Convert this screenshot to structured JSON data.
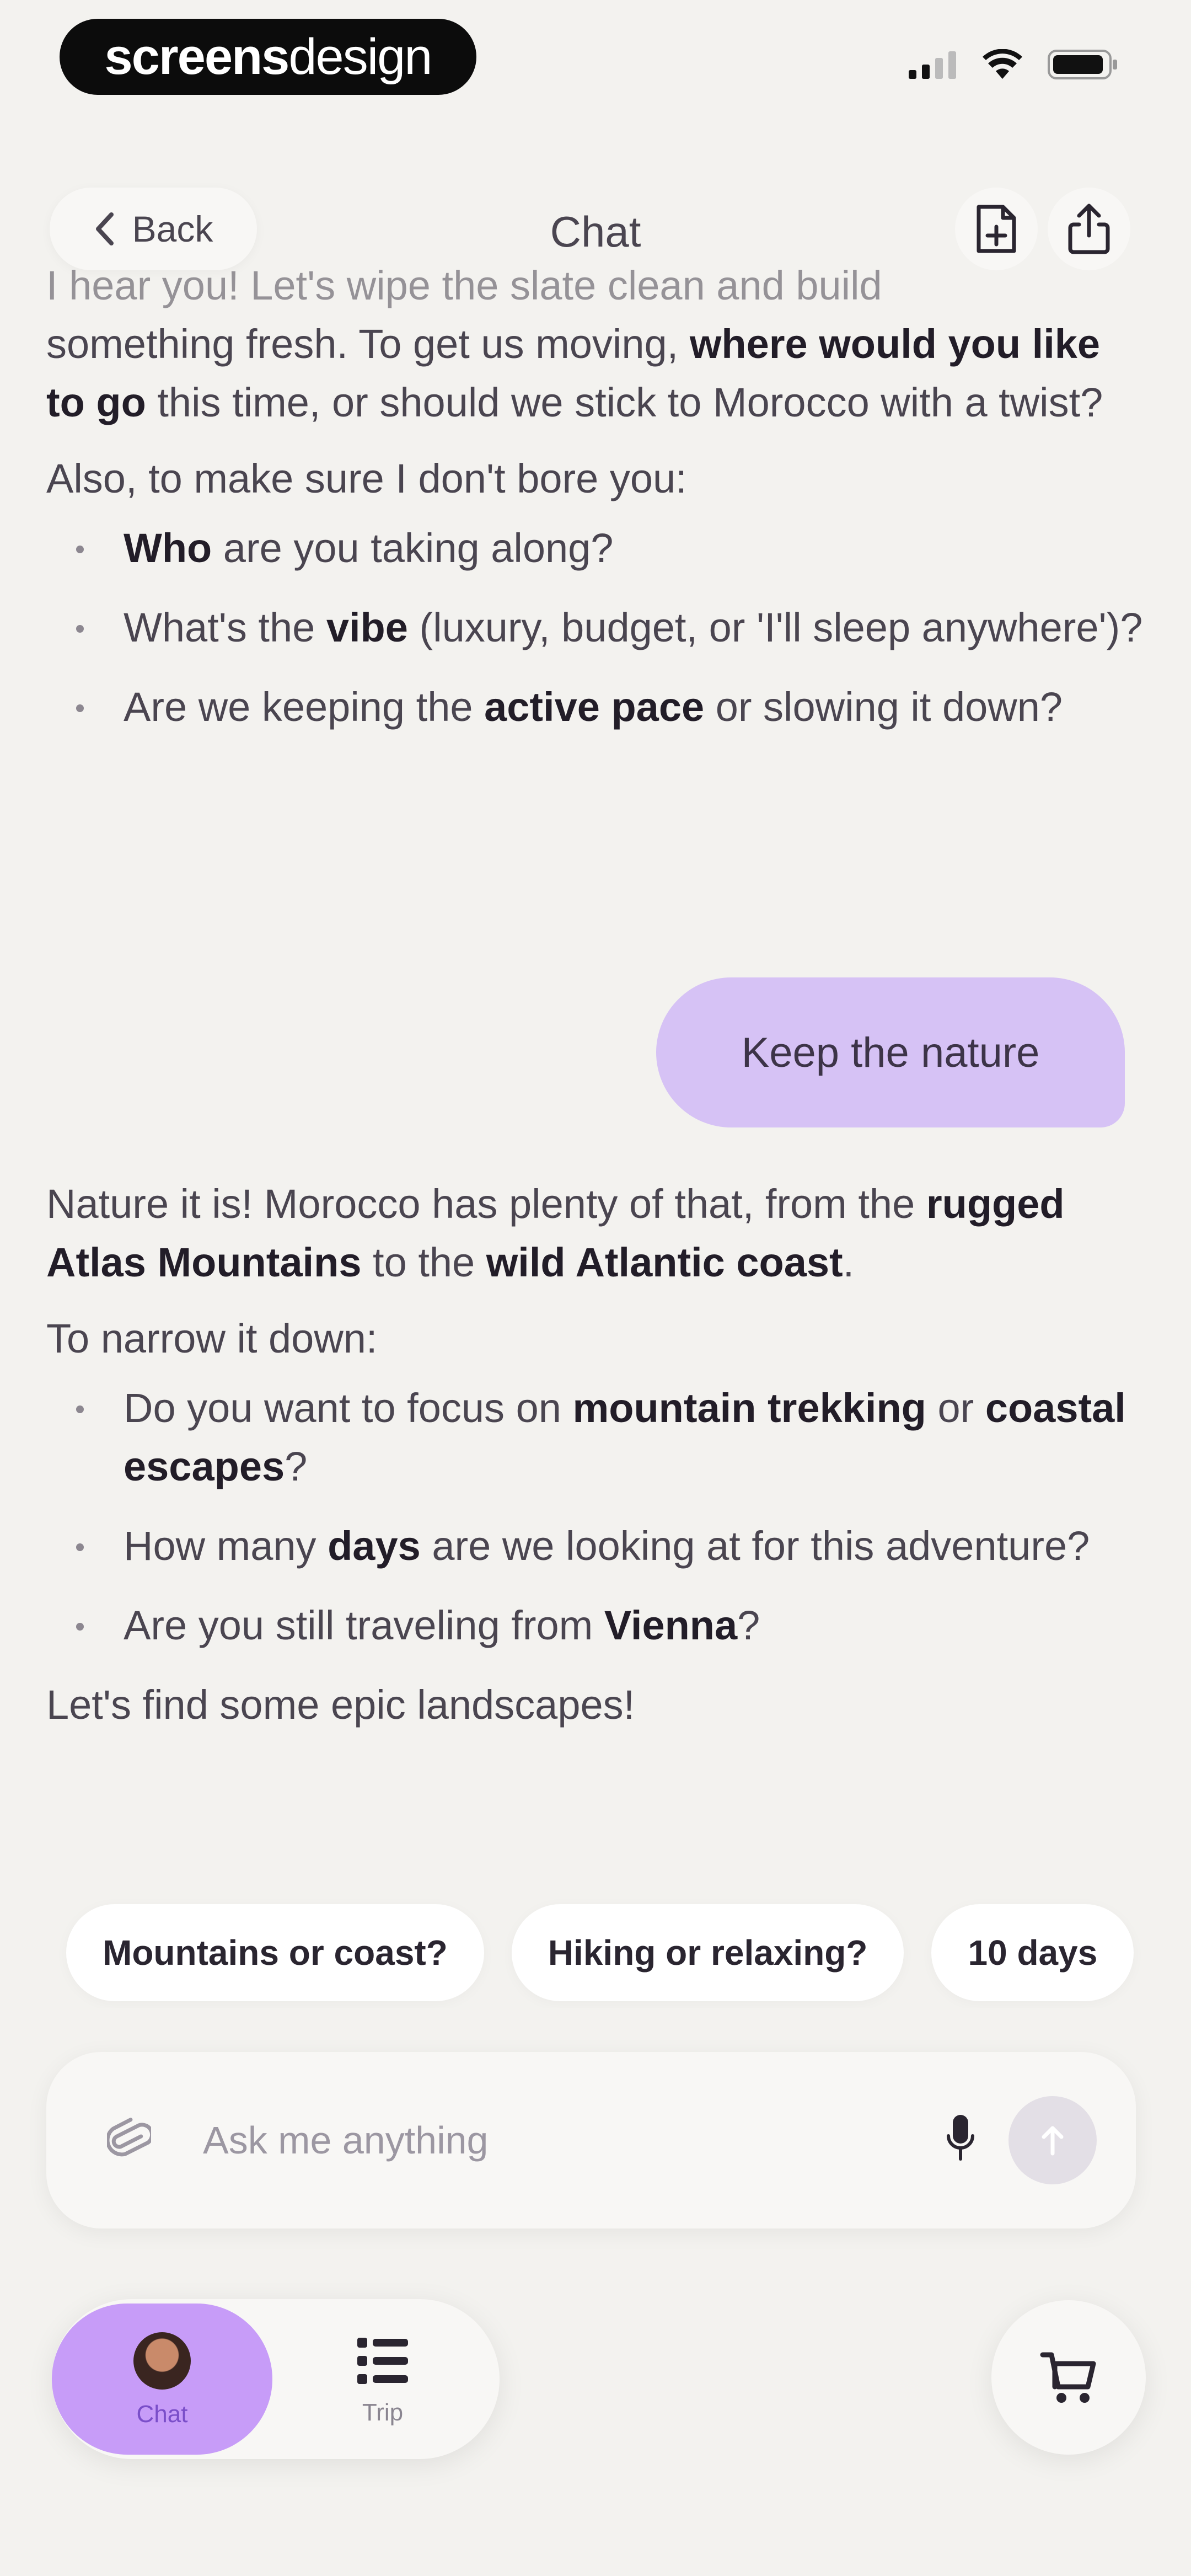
{
  "brand": {
    "part1": "screens",
    "part2": "design"
  },
  "header": {
    "back_label": "Back",
    "title": "Chat"
  },
  "messages": {
    "ai1_tail": "I hear you! Let's wipe the slate clean and build",
    "ai1_p1_a": "something fresh. To get us moving, ",
    "ai1_p1_b": "where would you like to go",
    "ai1_p1_c": " this time, or should we stick to Morocco with a twist?",
    "ai1_p2": "Also, to make sure I don't bore you:",
    "ai1_b1_a": "Who",
    "ai1_b1_b": " are you taking along?",
    "ai1_b2_a": "What's the ",
    "ai1_b2_b": "vibe",
    "ai1_b2_c": " (luxury, budget, or 'I'll sleep anywhere')?",
    "ai1_b3_a": "Are we keeping the ",
    "ai1_b3_b": "active pace",
    "ai1_b3_c": " or slowing it down?",
    "user1": "Keep the nature",
    "ai2_p1_a": "Nature it is! Morocco has plenty of that, from the ",
    "ai2_p1_b": "rugged Atlas Mountains",
    "ai2_p1_c": " to the ",
    "ai2_p1_d": "wild Atlantic coast",
    "ai2_p1_e": ".",
    "ai2_p2": "To narrow it down:",
    "ai2_b1_a": "Do you want to focus on ",
    "ai2_b1_b": "mountain trekking",
    "ai2_b1_c": " or ",
    "ai2_b1_d": "coastal escapes",
    "ai2_b1_e": "?",
    "ai2_b2_a": "How many ",
    "ai2_b2_b": "days",
    "ai2_b2_c": " are we looking at for this adventure?",
    "ai2_b3_a": "Are you still traveling from ",
    "ai2_b3_b": "Vienna",
    "ai2_b3_c": "?",
    "ai2_p3": "Let's find some epic landscapes!"
  },
  "chips": [
    "Mountains or coast?",
    "Hiking or relaxing?",
    "10 days"
  ],
  "composer": {
    "placeholder": "Ask me anything"
  },
  "tabs": {
    "chat": "Chat",
    "trip": "Trip"
  }
}
